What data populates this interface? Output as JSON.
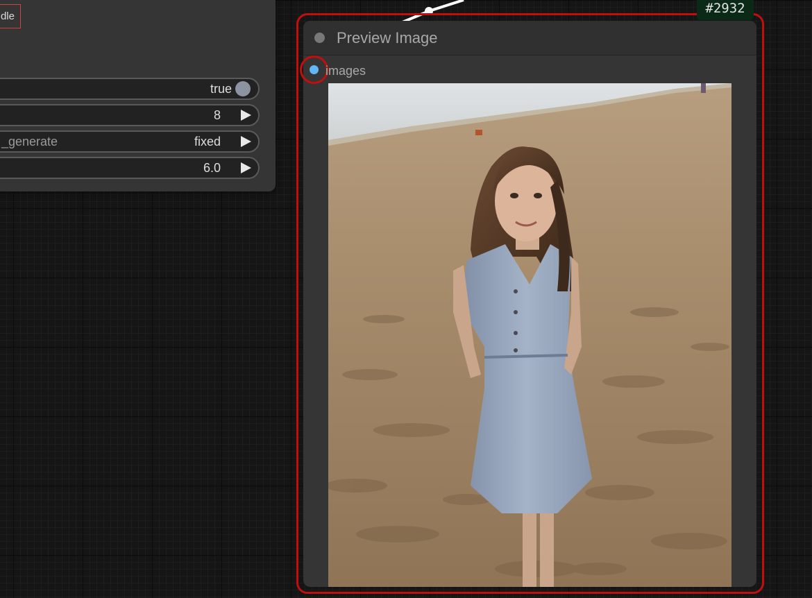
{
  "canvas": {
    "background": "#151515",
    "link_color": "#ffffff"
  },
  "left_node": {
    "badge_text": "dle",
    "widgets": [
      {
        "label": "",
        "value": "true",
        "kind": "toggle"
      },
      {
        "label": "",
        "value": "8",
        "kind": "number"
      },
      {
        "label": "_generate",
        "value": "fixed",
        "kind": "combo"
      },
      {
        "label": "",
        "value": "6.0",
        "kind": "number"
      }
    ]
  },
  "preview_node": {
    "id_badge": "#2932",
    "title": "Preview Image",
    "input_slot_label": "images",
    "input_slot_color": "#64b5f6",
    "selection_color": "#c10f0f",
    "image_icon": "generated-image-preview"
  }
}
